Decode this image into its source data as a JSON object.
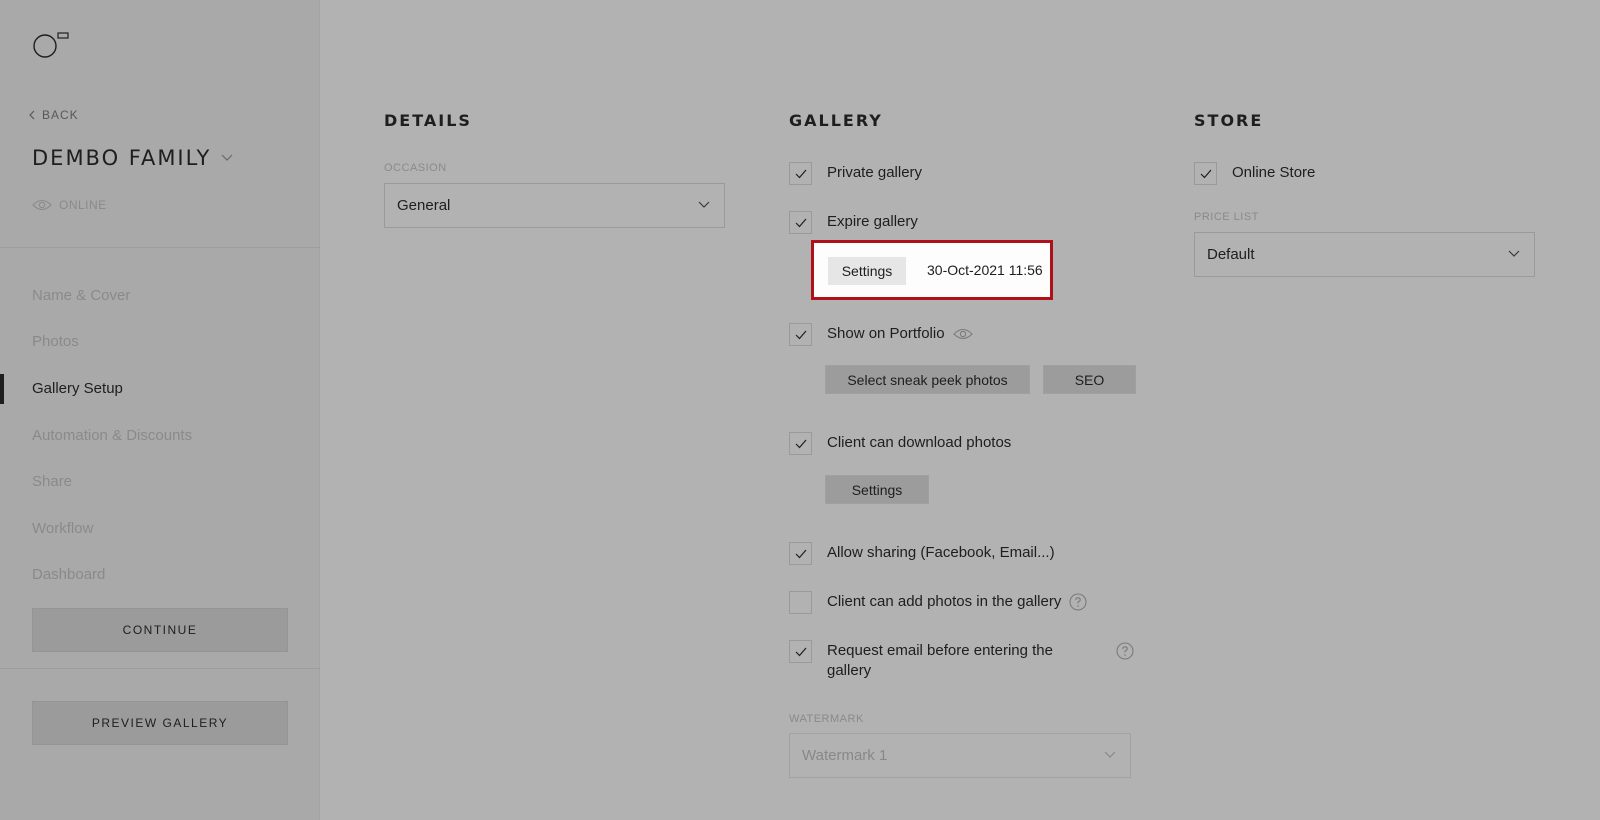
{
  "sidebar": {
    "back_label": "BACK",
    "gallery_name": "DEMBO FAMILY",
    "status": "ONLINE",
    "nav": [
      {
        "label": "Name & Cover",
        "active": false
      },
      {
        "label": "Photos",
        "active": false
      },
      {
        "label": "Gallery Setup",
        "active": true
      },
      {
        "label": "Automation & Discounts",
        "active": false
      },
      {
        "label": "Share",
        "active": false
      },
      {
        "label": "Workflow",
        "active": false
      },
      {
        "label": "Dashboard",
        "active": false
      }
    ],
    "continue_label": "CONTINUE",
    "preview_label": "PREVIEW GALLERY"
  },
  "details": {
    "title": "DETAILS",
    "occasion_label": "OCCASION",
    "occasion_value": "General"
  },
  "gallery": {
    "title": "GALLERY",
    "private": {
      "label": "Private gallery",
      "checked": true
    },
    "expire": {
      "label": "Expire gallery",
      "checked": true,
      "settings_label": "Settings",
      "date": "30-Oct-2021 11:56"
    },
    "portfolio": {
      "label": "Show on Portfolio",
      "checked": true,
      "sneak_peek_label": "Select sneak peek photos",
      "seo_label": "SEO"
    },
    "download": {
      "label": "Client can download photos",
      "checked": true,
      "settings_label": "Settings"
    },
    "sharing": {
      "label": "Allow sharing (Facebook, Email...)",
      "checked": true
    },
    "add_photos": {
      "label": "Client can add photos in the gallery",
      "checked": false
    },
    "request_email": {
      "label": "Request email before entering the gallery",
      "checked": true
    },
    "watermark_label": "WATERMARK",
    "watermark_value": "Watermark 1"
  },
  "store": {
    "title": "STORE",
    "online_store": {
      "label": "Online Store",
      "checked": true
    },
    "price_list_label": "PRICE LIST",
    "price_list_value": "Default"
  },
  "colors": {
    "highlight_border": "#b0101a",
    "active_indicator": "#1e1e1e"
  }
}
